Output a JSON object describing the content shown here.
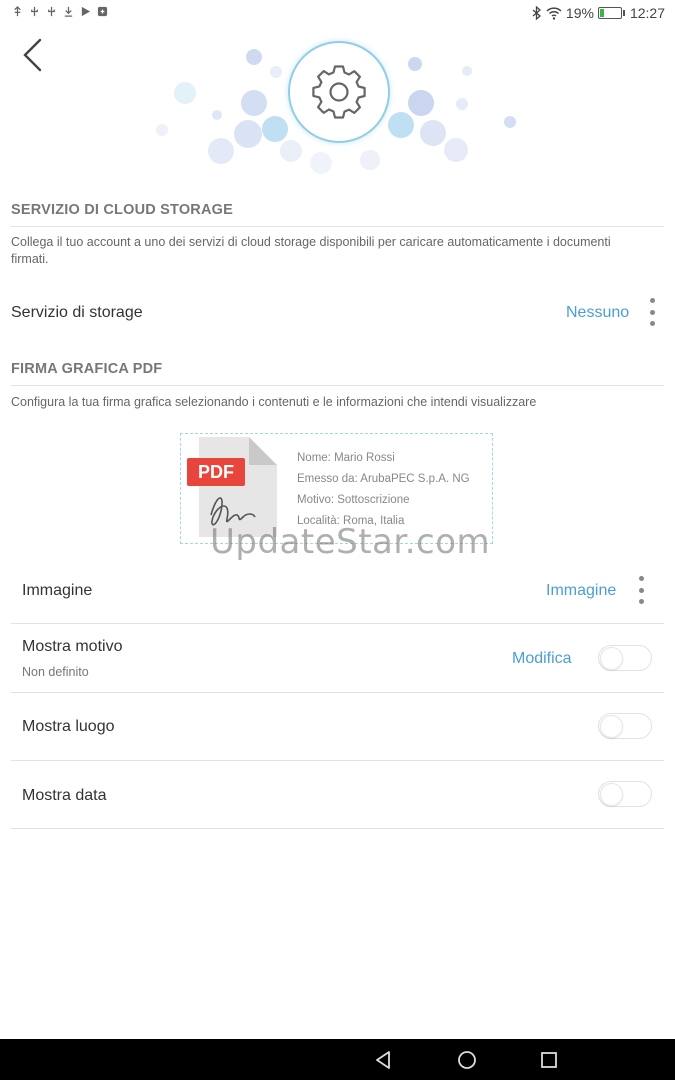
{
  "status_bar": {
    "icons_left": [
      "usb-icon",
      "usb-icon",
      "usb-icon",
      "download-icon",
      "play-store-icon",
      "notification-icon"
    ],
    "battery_percent": "19%",
    "battery_level": 0.19,
    "time": "12:27"
  },
  "header": {
    "back_icon": "chevron-left-icon",
    "settings_icon": "gear-icon"
  },
  "cloud": {
    "title": "SERVIZIO DI CLOUD STORAGE",
    "description": "Collega il tuo account a uno dei servizi di cloud storage disponibili per caricare automaticamente i documenti firmati.",
    "storage_label": "Servizio di storage",
    "storage_value": "Nessuno"
  },
  "firma": {
    "title": "FIRMA GRAFICA PDF",
    "description": "Configura la tua firma grafica selezionando i contenuti e le informazioni che intendi visualizzare",
    "preview": {
      "pdf_badge": "PDF",
      "lines": [
        "Nome: Mario Rossi",
        "Emesso da: ArubaPEC S.p.A. NG",
        "Motivo: Sottoscrizione",
        "Località: Roma, Italia"
      ]
    },
    "watermark": "UpdateStar.com",
    "rows": {
      "immagine": {
        "label": "Immagine",
        "value": "Immagine"
      },
      "motivo": {
        "label": "Mostra motivo",
        "sub": "Non definito",
        "action": "Modifica",
        "enabled": false
      },
      "luogo": {
        "label": "Mostra luogo",
        "enabled": false
      },
      "data": {
        "label": "Mostra data",
        "enabled": false
      }
    }
  },
  "nav_bar": {
    "icons": [
      "back-triangle-icon",
      "home-circle-icon",
      "recents-square-icon"
    ]
  },
  "colors": {
    "accent": "#4a9fd4",
    "gear_ring": "#8fcfe4",
    "pdf_red": "#e8453c"
  }
}
